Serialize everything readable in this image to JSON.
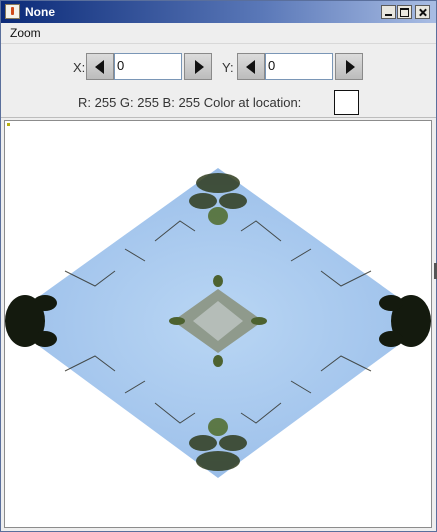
{
  "window": {
    "title": "None"
  },
  "menu": {
    "items": [
      {
        "label": "Zoom"
      }
    ]
  },
  "controls": {
    "x_label": "X:",
    "x_value": "0",
    "y_label": "Y:",
    "y_value": "0"
  },
  "color_info": {
    "text": "R: 255 G: 255 B: 255 Color at location:",
    "swatch_color": "#ffffff"
  },
  "image": {
    "description_colors": {
      "sky": "#a8c8ee",
      "foliage": "#2a3a1c",
      "background": "#ffffff"
    }
  }
}
